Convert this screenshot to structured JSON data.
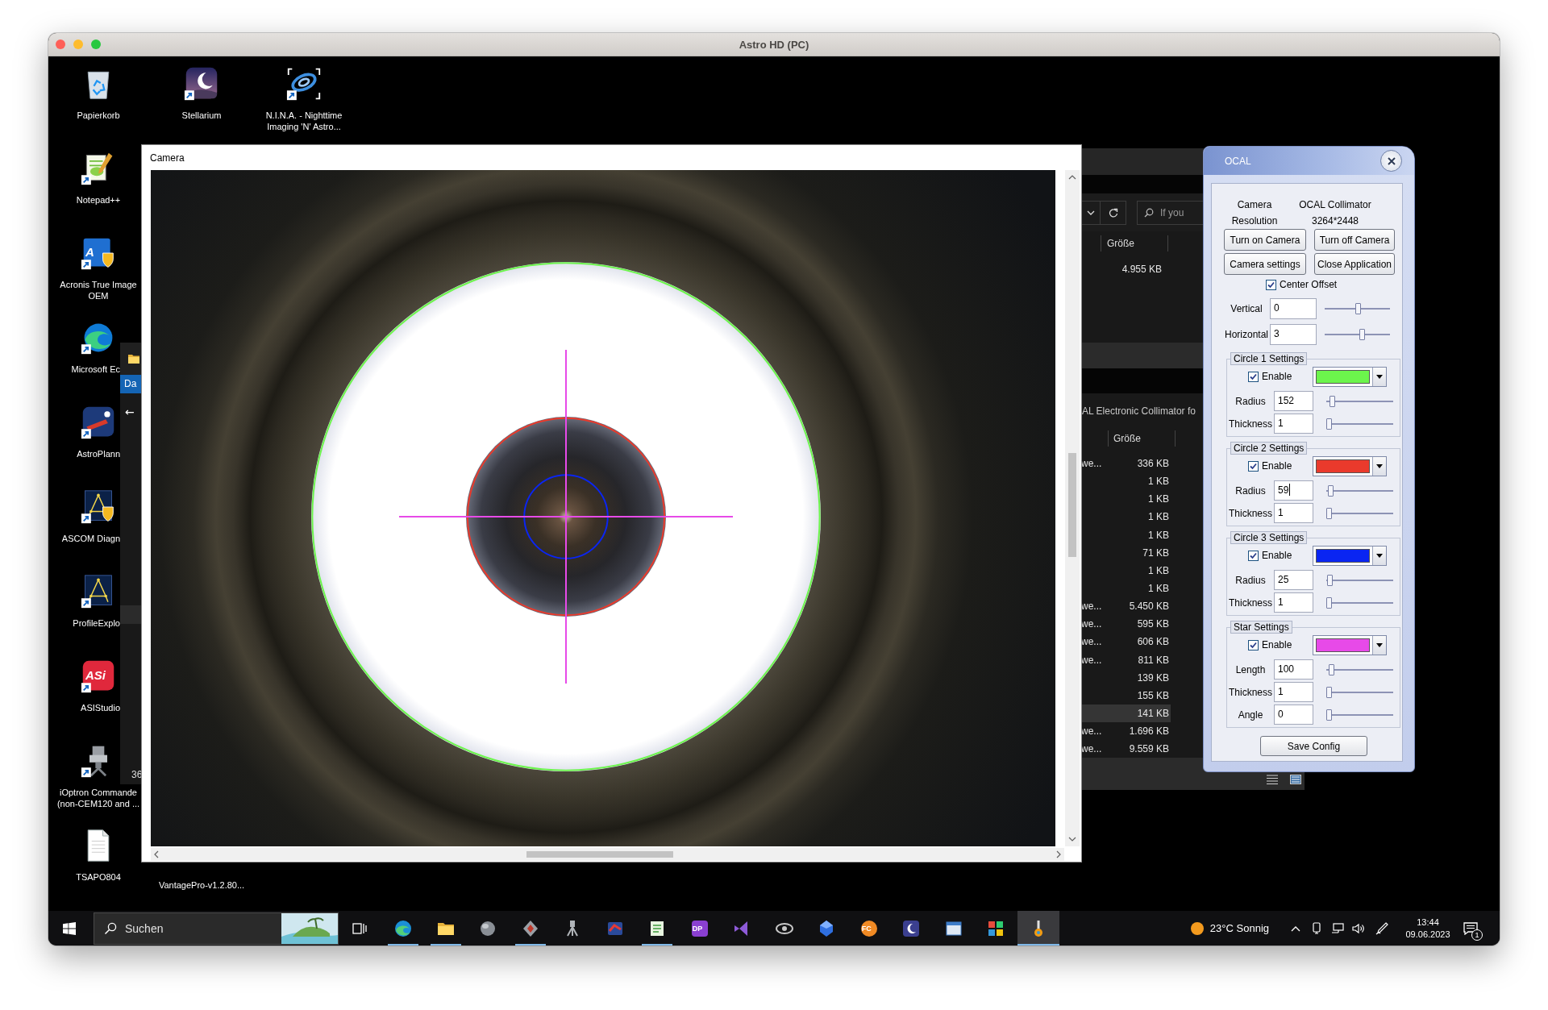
{
  "window": {
    "title": "Astro HD (PC)"
  },
  "desktop_icons": [
    {
      "label": "Papierkorb"
    },
    {
      "label": "Stellarium"
    },
    {
      "label": "N.I.N.A. - Nighttime Imaging 'N' Astro..."
    },
    {
      "label": "Notepad++"
    },
    {
      "label": "Acronis True Image OEM",
      "logo_text": "A"
    },
    {
      "label": "Microsoft Ec"
    },
    {
      "label": "AstroPlann"
    },
    {
      "label": "ASCOM Diagn"
    },
    {
      "label": "ProfileExplo"
    },
    {
      "label": "ASIStudio",
      "logo_text": "ASi"
    },
    {
      "label": "iOptron Commande (non-CEM120 and ..."
    },
    {
      "label": "TSAPO804"
    },
    {
      "label": "VantagePro-v1.2.80..."
    }
  ],
  "explorer_left": {
    "tab": "Da",
    "back": "←",
    "count": "36"
  },
  "camera_window": {
    "title": "Camera"
  },
  "explorer_upper": {
    "search": {
      "placeholder": "If you"
    },
    "column": "Größe",
    "rows": [
      {
        "size": "4.955 KB"
      }
    ]
  },
  "explorer_lower": {
    "path": "AL Electronic Collimator fo",
    "column": "Größe",
    "rows": [
      {
        "column_1": "we...",
        "size": "336 KB",
        "selected": false
      },
      {
        "size": "1 KB",
        "selected": false
      },
      {
        "size": "1 KB",
        "selected": false
      },
      {
        "size": "1 KB",
        "selected": false
      },
      {
        "size": "1 KB",
        "selected": false
      },
      {
        "size": "71 KB",
        "selected": false
      },
      {
        "size": "1 KB",
        "selected": false
      },
      {
        "size": "1 KB",
        "selected": false
      },
      {
        "column_1": "we...",
        "size": "5.450 KB",
        "selected": false
      },
      {
        "column_1": "we...",
        "size": "595 KB",
        "selected": false
      },
      {
        "column_1": "we...",
        "size": "606 KB",
        "selected": false
      },
      {
        "column_1": "we...",
        "size": "811 KB",
        "selected": false
      },
      {
        "size": "139 KB",
        "selected": false
      },
      {
        "size": "155 KB",
        "selected": false
      },
      {
        "size": "141 KB",
        "selected": true
      },
      {
        "column_1": "we...",
        "size": "1.696 KB",
        "selected": false
      },
      {
        "column_1": "we...",
        "size": "9.559 KB",
        "selected": false
      }
    ]
  },
  "ocal": {
    "title": "OCAL",
    "info": [
      {
        "label": "Camera",
        "value": "OCAL Collimator"
      },
      {
        "label": "Resolution",
        "value": "3264*2448"
      }
    ],
    "buttons": [
      {
        "label": "Turn on Camera"
      },
      {
        "label": "Turn off Camera"
      },
      {
        "label": "Camera settings"
      },
      {
        "label": "Close Application"
      }
    ],
    "center_offset": {
      "label": "Center Offset",
      "checked": true,
      "fields": [
        {
          "label": "Vertical",
          "value": "0",
          "level": 0.52,
          "focused": false
        },
        {
          "label": "Horizontal",
          "value": "3",
          "level": 0.58,
          "focused": false
        }
      ]
    },
    "groups": [
      {
        "kind": "circle",
        "title": "Circle 1 Settings",
        "enable": "Enable",
        "checked": true,
        "color": "#6cf54c",
        "fields": [
          {
            "label": "Radius",
            "value": "152",
            "level": 0.05,
            "focused": false
          },
          {
            "label": "Thickness",
            "value": "1",
            "level": 0.0,
            "focused": false
          }
        ]
      },
      {
        "kind": "circle",
        "title": "Circle 2 Settings",
        "enable": "Enable",
        "checked": true,
        "color": "#ea3a2c",
        "fields": [
          {
            "label": "Radius",
            "value": "59",
            "level": 0.03,
            "focused": true
          },
          {
            "label": "Thickness",
            "value": "1",
            "level": 0.0,
            "focused": false
          }
        ]
      },
      {
        "kind": "circle",
        "title": "Circle 3 Settings",
        "enable": "Enable",
        "checked": true,
        "color": "#0a25f2",
        "fields": [
          {
            "label": "Radius",
            "value": "25",
            "level": 0.01,
            "focused": false
          },
          {
            "label": "Thickness",
            "value": "1",
            "level": 0.0,
            "focused": false
          }
        ]
      },
      {
        "kind": "star",
        "title": "Star Settings",
        "enable": "Enable",
        "checked": true,
        "color": "#e74ae8",
        "fields": [
          {
            "label": "Length",
            "value": "100",
            "level": 0.04,
            "focused": false
          },
          {
            "label": "Thickness",
            "value": "1",
            "level": 0.0,
            "focused": false
          },
          {
            "label": "Angle",
            "value": "0",
            "level": 0.0,
            "focused": false
          }
        ]
      }
    ],
    "save_button": "Save Config"
  },
  "taskbar": {
    "search": {
      "placeholder": "Suchen"
    },
    "apps": [
      {
        "running": true,
        "selected": false
      },
      {
        "running": true,
        "selected": false
      },
      {
        "running": false,
        "selected": false
      },
      {
        "running": true,
        "selected": false
      },
      {
        "running": false,
        "selected": false
      },
      {
        "running": false,
        "selected": false
      },
      {
        "running": true,
        "selected": false
      },
      {
        "running": false,
        "logo_text": "DP",
        "selected": false
      },
      {
        "running": false,
        "selected": false
      },
      {
        "running": false,
        "selected": false
      },
      {
        "running": false,
        "selected": false
      },
      {
        "running": false,
        "logo_text": "FC",
        "selected": false
      },
      {
        "running": false,
        "selected": false
      },
      {
        "running": false,
        "selected": false
      },
      {
        "running": false,
        "selected": false
      },
      {
        "running": true,
        "selected": true
      }
    ],
    "weather": "23°C Sonnig",
    "time": "13:44",
    "date": "09.06.2023",
    "notifications": "1"
  }
}
